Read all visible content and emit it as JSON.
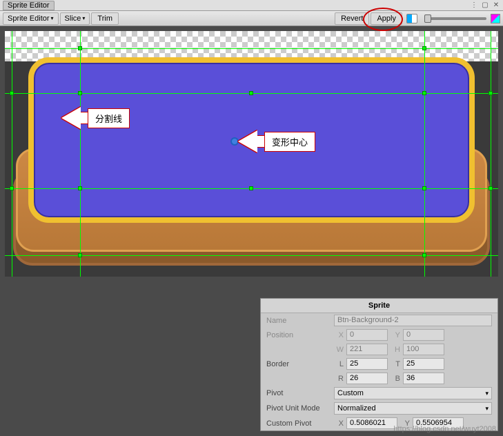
{
  "titlebar": {
    "title": "Sprite Editor"
  },
  "toolbar": {
    "editor_dropdown": "Sprite Editor",
    "slice_dropdown": "Slice",
    "trim_btn": "Trim",
    "revert_btn": "Revert",
    "apply_btn": "Apply"
  },
  "callouts": {
    "split_line": "分割线",
    "deform_center": "变形中心"
  },
  "inspector": {
    "header": "Sprite",
    "name_label": "Name",
    "name_value": "Btn-Background-2",
    "position_label": "Position",
    "position": {
      "x_label": "X",
      "x": "0",
      "y_label": "Y",
      "y": "0",
      "w_label": "W",
      "w": "221",
      "h_label": "H",
      "h": "100"
    },
    "border_label": "Border",
    "border": {
      "l_label": "L",
      "l": "25",
      "t_label": "T",
      "t": "25",
      "r_label": "R",
      "r": "26",
      "b_label": "B",
      "b": "36"
    },
    "pivot_label": "Pivot",
    "pivot_value": "Custom",
    "pivot_unit_label": "Pivot Unit Mode",
    "pivot_unit_value": "Normalized",
    "custom_pivot_label": "Custom Pivot",
    "custom_pivot": {
      "x_label": "X",
      "x": "0.5086021",
      "y_label": "Y",
      "y": "0.5506954"
    }
  },
  "watermark": "https://blog.csdn.net/wuyt2008"
}
